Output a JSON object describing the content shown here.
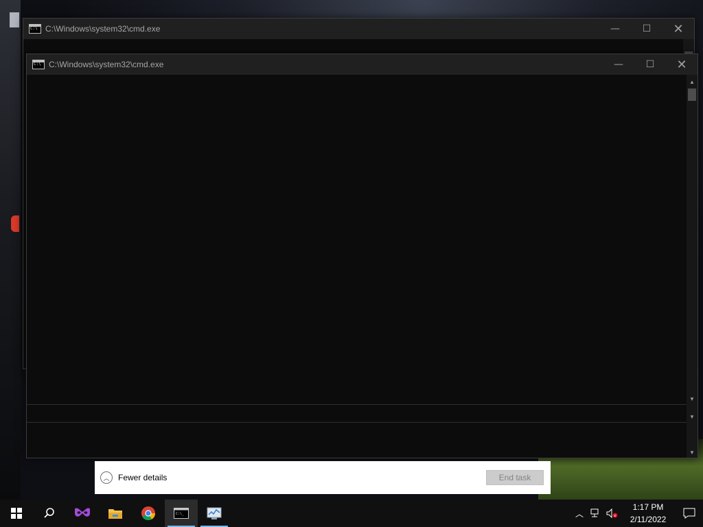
{
  "windows": {
    "back": {
      "title": "C:\\Windows\\system32\\cmd.exe"
    },
    "front": {
      "title": "C:\\Windows\\system32\\cmd.exe"
    }
  },
  "window_controls": {
    "minimize": "—",
    "maximize": "☐",
    "close": "✕"
  },
  "task_manager_footer": {
    "fewer_details_label": "Fewer details",
    "end_task_label": "End task",
    "end_task_enabled": false
  },
  "taskbar": {
    "apps": [
      {
        "name": "start",
        "icon": "windows-logo-icon"
      },
      {
        "name": "search",
        "icon": "search-icon"
      },
      {
        "name": "mask-app",
        "icon": "mask-icon"
      },
      {
        "name": "file-explorer",
        "icon": "folder-icon"
      },
      {
        "name": "chrome",
        "icon": "chrome-icon"
      },
      {
        "name": "cmd",
        "icon": "cmd-icon",
        "active": true
      },
      {
        "name": "task-manager",
        "icon": "task-manager-icon"
      }
    ],
    "clock": {
      "time": "1:17 PM",
      "date": "2/11/2022"
    }
  },
  "colors": {
    "titlebar": "#202020",
    "console_bg": "#0c0c0c",
    "taskbar": "#101010",
    "accent": "#76b9ed"
  }
}
